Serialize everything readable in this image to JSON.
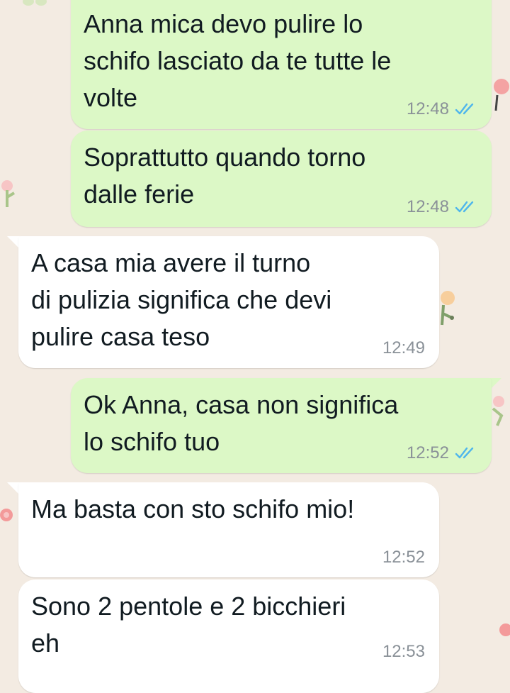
{
  "colors": {
    "background": "#f3ebe2",
    "outgoing_bubble": "#dcf8c6",
    "incoming_bubble": "#ffffff",
    "read_ticks": "#4fb6ec",
    "timestamp": "#8a9198",
    "text": "#111b21"
  },
  "messages": [
    {
      "direction": "outgoing",
      "text": "Anna mica devo pulire lo\nschifo lasciato da te tutte le\nvolte",
      "time": "12:48",
      "status_icon": "double-check-read-icon"
    },
    {
      "direction": "outgoing",
      "text": "Soprattutto quando torno\ndalle ferie",
      "time": "12:48",
      "status_icon": "double-check-read-icon"
    },
    {
      "direction": "incoming",
      "text": "A casa mia avere il turno\ndi pulizia significa che devi\npulire casa teso",
      "time": "12:49"
    },
    {
      "direction": "outgoing",
      "text": "Ok Anna, casa non significa\nlo schifo tuo",
      "time": "12:52",
      "status_icon": "double-check-read-icon"
    },
    {
      "direction": "incoming",
      "text": "Ma basta con sto schifo mio!",
      "time": "12:52"
    },
    {
      "direction": "incoming",
      "text": "Sono 2 pentole e 2 bicchieri\neh",
      "time": "12:53"
    }
  ]
}
